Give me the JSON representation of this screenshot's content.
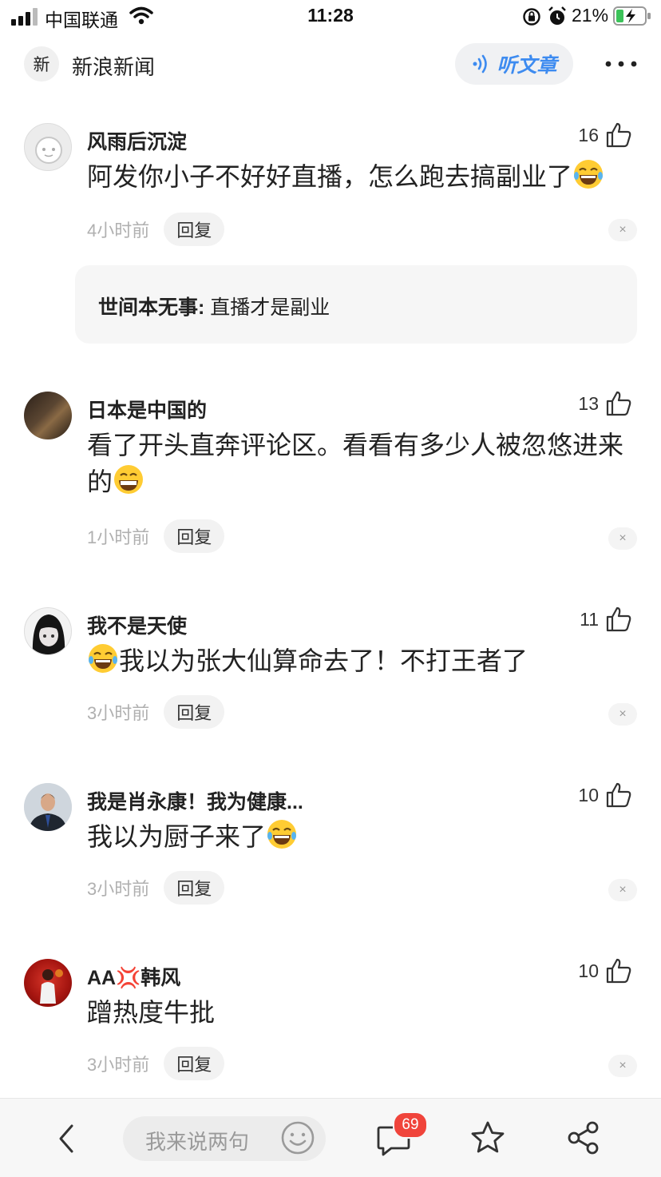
{
  "status_bar": {
    "carrier": "中国联通",
    "time": "11:28",
    "battery": "21%"
  },
  "header": {
    "logo_text": "新",
    "app_name": "新浪新闻",
    "listen_label": "听文章"
  },
  "comments": [
    {
      "author": "风雨后沉淀",
      "likes": "16",
      "text": "阿发你小子不好好直播，怎么跑去搞副业了",
      "time": "4小时前",
      "reply_label": "回复"
    },
    {
      "author": "日本是中国的",
      "likes": "13",
      "text": "看了开头直奔评论区。看看有多少人被忽悠进来的",
      "time": "1小时前",
      "reply_label": "回复"
    },
    {
      "author": "我不是天使",
      "likes": "11",
      "text": "我以为张大仙算命去了！不打王者了",
      "time": "3小时前",
      "reply_label": "回复"
    },
    {
      "author": "我是肖永康！我为健康...",
      "likes": "10",
      "text": "我以为厨子来了",
      "time": "3小时前",
      "reply_label": "回复"
    },
    {
      "author": "AA💢韩风",
      "likes": "10",
      "text": "蹭热度牛批",
      "time": "3小时前",
      "reply_label": "回复"
    }
  ],
  "sub_reply": {
    "author": "世间本无事:",
    "text": " 直播才是副业"
  },
  "close_glyph": "×",
  "bottom_bar": {
    "input_placeholder": "我来说两句",
    "comment_count": "69"
  },
  "colors": {
    "accent_blue": "#3d8bf0",
    "badge_red": "#f0443b"
  }
}
